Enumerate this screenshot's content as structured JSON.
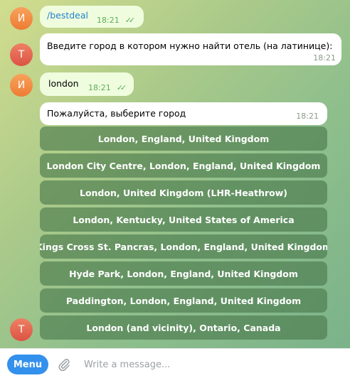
{
  "messages": [
    {
      "avatar": "И",
      "text": "/bestdeal",
      "time": "18:21",
      "checks": "✓✓"
    },
    {
      "avatar": "Т",
      "text": "Введите город в котором нужно найти отель (на латинице):",
      "time": "18:21"
    },
    {
      "avatar": "И",
      "text": "london",
      "time": "18:21",
      "checks": "✓✓"
    },
    {
      "avatar": "Т",
      "text": "Пожалуйста, выберите город",
      "time": "18:21"
    }
  ],
  "keyboard": [
    "London, England, United Kingdom",
    "London City Centre, London, England, United Kingdom",
    "London, United Kingdom (LHR-Heathrow)",
    "London, Kentucky, United States of America",
    "Kings Cross St. Pancras, London, England, United Kingdom",
    "Hyde Park, London, England, United Kingdom",
    "Paddington, London, England, United Kingdom",
    "London (and vicinity), Ontario, Canada"
  ],
  "composer": {
    "menu_label": "Menu",
    "placeholder": "Write a message...",
    "attach_icon": "paperclip-icon"
  },
  "colors": {
    "outgoing_bubble": "#effdde",
    "incoming_bubble": "#ffffff",
    "menu_button": "#3390ec",
    "avatar_user": "#f28c45",
    "avatar_bot": "#e35f4c"
  }
}
